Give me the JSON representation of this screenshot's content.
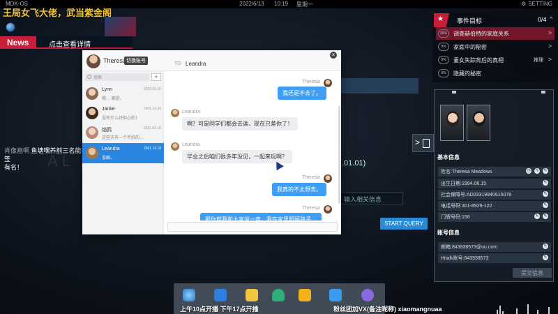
{
  "topbar": {
    "os": "MDK-OS",
    "date": "2022/6/13",
    "time": "10:19",
    "weekday": "星期一",
    "settings": "SETTING"
  },
  "stream": {
    "title": "王局女飞大佬，武当紫金阁"
  },
  "news": {
    "label": "News",
    "link": "点击查看详情"
  },
  "danmaku": {
    "nick": "肖像画啊",
    "text": "鱼塘嘿养前三名能在直播间互动并抽签",
    "text2": "有名！"
  },
  "background": {
    "date_fragment": ".01.01)",
    "query_placeholder": "输入相关信息",
    "start_query": "START QUERY",
    "watermark": "AL"
  },
  "chat": {
    "user": "Theresa",
    "switch": "切换账号",
    "to_label": "TO",
    "to_name": "Leandra",
    "close": "×",
    "search_placeholder": "搜索",
    "add": "+",
    "contacts": [
      {
        "name": "Lynn",
        "date": "2022.02.20",
        "preview": "嗯… 都是。"
      },
      {
        "name": "Janke",
        "date": "2021.12.20",
        "preview": "没有什么好担心的！"
      },
      {
        "name": "焰鸥",
        "date": "2021.01.10",
        "preview": "这些天有一个不好的…"
      },
      {
        "name": "Leandra",
        "date": "2021.12.18",
        "preview": "没聊。"
      }
    ],
    "messages": [
      {
        "from": "Theresa",
        "text": "我还是不去了。"
      },
      {
        "from": "Leandra",
        "text": "啊？可是同学们都会去诶，现在只差你了！"
      },
      {
        "from": "Leandra",
        "text": "毕业之后咱们很多年没见，一起来玩啊？"
      },
      {
        "from": "Theresa",
        "text": "我真的不太想去。"
      },
      {
        "from": "Theresa",
        "text": "那你帮我和大家说一声，我在家里照顾孩子…"
      }
    ]
  },
  "mission": {
    "title": "事件目标",
    "count": "0/4",
    "collapse": "^",
    "tasks": [
      {
        "pct": "35%",
        "label": "调查赫伯特的家庭关系",
        "extra": "",
        "arrow": ">"
      },
      {
        "pct": "0%",
        "label": "家庭中的秘密",
        "extra": "",
        "arrow": ">"
      },
      {
        "pct": "0%",
        "label": "妻女失踪背后的真相",
        "extra": "推理",
        "arrow": ">"
      },
      {
        "pct": "0%",
        "label": "隐藏的秘密",
        "extra": "",
        "arrow": ""
      }
    ]
  },
  "profile": {
    "basic_title": "基本信息",
    "basic": [
      "姓名:Theresa Meadows",
      "出生日期:1994.06.15",
      "社会保障号:AD03319940615078",
      "电话号码:301-8929-122",
      "门牌号码:156"
    ],
    "account_title": "账号信息",
    "accounts": [
      "邮箱:843938573@uu.com",
      "Hitalk账号:843938573"
    ],
    "submit": "提交信息",
    "tab_arrow": ">"
  },
  "taskbar": {
    "overlay": "上午10点开播 下午17点开播",
    "overlay2": "粉丝团加VX(备注昵称)",
    "handle": "xiaomangnuaa"
  }
}
